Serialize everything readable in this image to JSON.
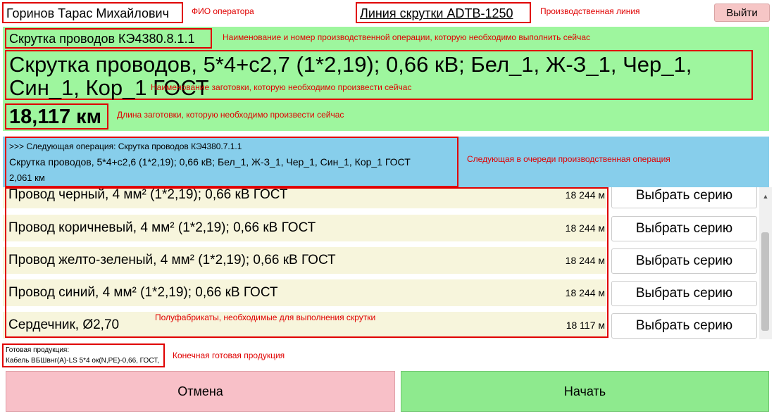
{
  "header": {
    "operator_name": "Горинов Тарас Михайлович",
    "line_name": "Линия скрутки ADTB-1250",
    "exit_label": "Выйти"
  },
  "current": {
    "op_code": "Скрутка проводов КЭ4380.8.1.1",
    "product_name": "Скрутка проводов, 5*4+с2,7 (1*2,19); 0,66 кВ; Бел_1, Ж-З_1, Чер_1, Син_1, Кор_1 ГОСТ",
    "length": "18,117 км"
  },
  "next": {
    "operation": ">>> Следующая операция: Скрутка проводов КЭ4380.7.1.1",
    "product": "Скрутка проводов, 5*4+с2,6 (1*2,19); 0,66 кВ; Бел_1, Ж-З_1, Чер_1, Син_1, Кор_1 ГОСТ",
    "length": "2,061 км"
  },
  "materials": [
    {
      "name": "Провод черный, 4 мм² (1*2,19); 0,66 кВ ГОСТ",
      "qty": "18 244 м",
      "button": "Выбрать серию"
    },
    {
      "name": "Провод коричневый, 4 мм² (1*2,19); 0,66 кВ ГОСТ",
      "qty": "18 244 м",
      "button": "Выбрать серию"
    },
    {
      "name": "Провод желто-зеленый, 4 мм² (1*2,19); 0,66 кВ ГОСТ",
      "qty": "18 244 м",
      "button": "Выбрать серию"
    },
    {
      "name": "Провод синий, 4 мм² (1*2,19); 0,66 кВ ГОСТ",
      "qty": "18 244 м",
      "button": "Выбрать серию"
    },
    {
      "name": "Сердечник, Ø2,70",
      "qty": "18 117 м",
      "button": "Выбрать серию"
    }
  ],
  "final_product": {
    "label": "Готовая продукция:",
    "name": "Кабель ВБШвнг(А)-LS 5*4 ок(N,PE)-0,66, ГОСТ,"
  },
  "footer": {
    "cancel_label": "Отмена",
    "start_label": "Начать"
  },
  "annotations": {
    "operator": "ФИО оператора",
    "line": "Производственная линия",
    "operation": "Наименование и номер производственной операции, которую необходимо выполнить сейчас",
    "product": "Наименование заготовки, которую необходимо произвести сейчас",
    "length": "Длина заготовки, которую необходимо произвести сейчас",
    "next": "Следующая в очереди производственная операция",
    "materials": "Полуфабрикаты, необходимые для выполнения скрутки",
    "final": "Конечная готовая продукция"
  },
  "colors": {
    "current_panel": "#9ef69e",
    "next_panel": "#87ceeb",
    "highlight_border": "#e00000",
    "cancel_button": "#f8c0c8",
    "start_button": "#8eea8e",
    "exit_button": "#f6c6c6"
  }
}
